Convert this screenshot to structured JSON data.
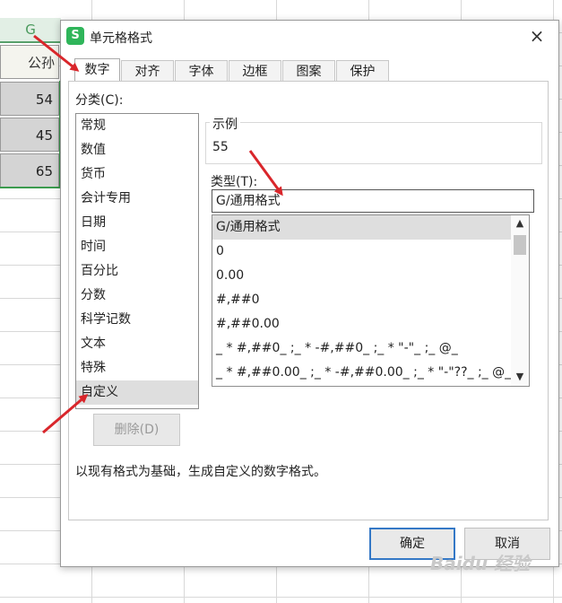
{
  "sheet": {
    "column_header": "G",
    "header_cell": "公孙",
    "values": [
      "54",
      "45",
      "65"
    ]
  },
  "dialog": {
    "app_icon": "S",
    "title": "单元格格式",
    "close_glyph": "×",
    "tabs": [
      "数字",
      "对齐",
      "字体",
      "边框",
      "图案",
      "保护"
    ],
    "active_tab": "数字",
    "category_label": "分类(C):",
    "categories": [
      "常规",
      "数值",
      "货币",
      "会计专用",
      "日期",
      "时间",
      "百分比",
      "分数",
      "科学记数",
      "文本",
      "特殊",
      "自定义"
    ],
    "selected_category": "自定义",
    "delete_button": "删除(D)",
    "sample_label": "示例",
    "sample_value": "55",
    "type_label": "类型(T):",
    "type_input_value": "G/通用格式",
    "type_list": [
      "G/通用格式",
      "0",
      "0.00",
      "#,##0",
      "#,##0.00",
      "_ * #,##0_ ;_ * -#,##0_ ;_ * \"-\"_ ;_ @_",
      "_ * #,##0.00_ ;_ * -#,##0.00_ ;_ * \"-\"??_ ;_ @_"
    ],
    "selected_type": "G/通用格式",
    "description": "以现有格式为基础，生成自定义的数字格式。",
    "ok_button": "确定",
    "cancel_button": "取消"
  },
  "watermark": "Baidu 经验",
  "colors": {
    "annotation_arrow": "#d9262b",
    "ok_border": "#3478c6",
    "app_icon": "#2fb55a",
    "selected_bg": "#dedede"
  },
  "icons": [
    "app-icon",
    "close-icon",
    "scroll-up-icon",
    "scroll-down-icon"
  ]
}
